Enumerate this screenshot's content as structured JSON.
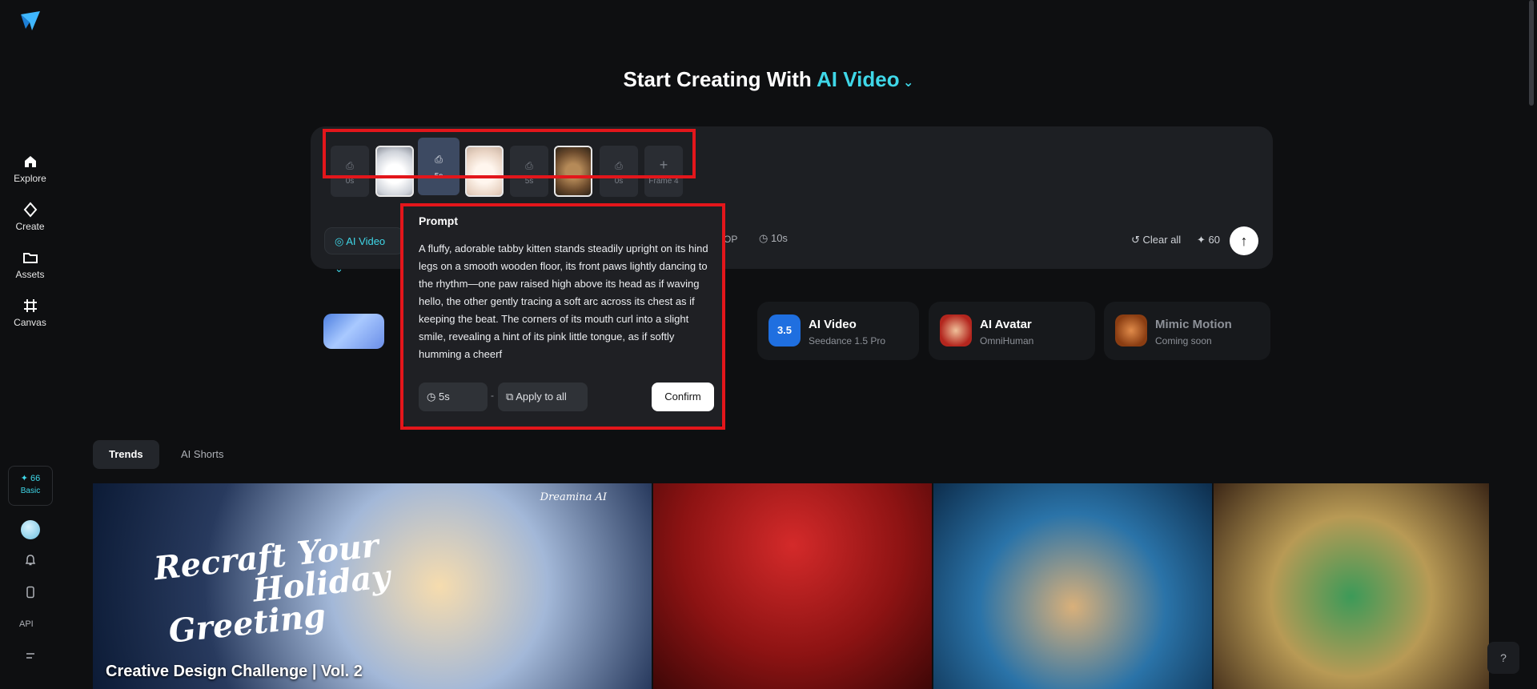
{
  "sidebar": {
    "nav": [
      {
        "label": "Explore",
        "icon": "home-icon"
      },
      {
        "label": "Create",
        "icon": "diamond-icon"
      },
      {
        "label": "Assets",
        "icon": "folder-icon"
      },
      {
        "label": "Canvas",
        "icon": "canvas-icon"
      }
    ],
    "credits": "✦ 66",
    "plan": "Basic",
    "api_label": "API"
  },
  "hero": {
    "title_prefix": "Start Creating With",
    "title_accent": "AI Video",
    "accent_color": "#3fd7e8"
  },
  "frames": [
    {
      "type": "empty",
      "label": "0s"
    },
    {
      "type": "image",
      "desc": "white kitten"
    },
    {
      "type": "active",
      "label": "5s"
    },
    {
      "type": "image",
      "desc": "cream kitten"
    },
    {
      "type": "empty",
      "label": "5s"
    },
    {
      "type": "image",
      "desc": "tabby kitten"
    },
    {
      "type": "empty",
      "label": "0s"
    },
    {
      "type": "add",
      "label": "Frame 4"
    }
  ],
  "composer": {
    "mode_label": "AI Video",
    "op_fragment": "OP",
    "duration": "10s",
    "clear_all": "Clear all",
    "cost": "✦ 60"
  },
  "prompt_popup": {
    "title": "Prompt",
    "text": "A fluffy, adorable tabby kitten stands steadily upright on its hind legs on a smooth wooden floor, its front paws lightly dancing to the rhythm—one paw raised high above its head as if waving hello, the other gently tracing a soft arc across its chest as if keeping the beat. The corners of its mouth curl into a slight smile, revealing a hint of its pink little tongue, as if softly humming a cheerf",
    "duration": "5s",
    "apply_all": "Apply to all",
    "confirm": "Confirm"
  },
  "tools": [
    {
      "title": "AI Video",
      "sub": "Seedance 1.5 Pro",
      "icon": "seedance-icon"
    },
    {
      "title": "AI Avatar",
      "sub": "OmniHuman",
      "icon": "avatar-icon"
    },
    {
      "title": "Mimic Motion",
      "sub": "Coming soon",
      "icon": "motion-icon"
    }
  ],
  "tabs": [
    "Trends",
    "AI Shorts"
  ],
  "gallery": {
    "headline": "Creative Design Challenge | Vol. 2",
    "holiday_lines": [
      "Recraft Your",
      "Holiday",
      "Greeting"
    ],
    "brand": "Dreamina AI"
  }
}
